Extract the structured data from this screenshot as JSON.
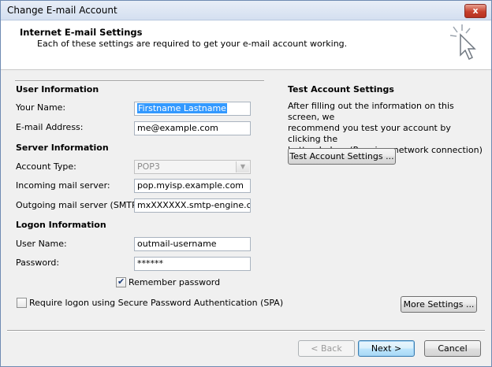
{
  "window": {
    "title": "Change E-mail Account",
    "close_label": "x"
  },
  "header": {
    "title": "Internet E-mail Settings",
    "subtitle": "Each of these settings are required to get your e-mail account working."
  },
  "user_info": {
    "section": "User Information",
    "name_label": "Your Name:",
    "name_value": "Firstname Lastname",
    "email_label": "E-mail Address:",
    "email_value": "me@example.com"
  },
  "server_info": {
    "section": "Server Information",
    "account_type_label": "Account Type:",
    "account_type_value": "POP3",
    "incoming_label": "Incoming mail server:",
    "incoming_value": "pop.myisp.example.com",
    "outgoing_label": "Outgoing mail server (SMTP):",
    "outgoing_value": "mxXXXXXX.smtp-engine.com"
  },
  "logon_info": {
    "section": "Logon Information",
    "user_label": "User Name:",
    "user_value": "outmail-username",
    "password_label": "Password:",
    "password_value": "******",
    "remember_label": "Remember password",
    "remember_checked": true,
    "spa_label": "Require logon using Secure Password Authentication (SPA)",
    "spa_checked": false
  },
  "test_settings": {
    "section": "Test Account Settings",
    "description_lines": [
      "After filling out the information on this screen, we",
      "recommend you test your account by clicking the",
      "button below. (Requires network connection)"
    ],
    "button_label": "Test Account Settings ..."
  },
  "more_settings_label": "More Settings ...",
  "footer": {
    "back_label": "< Back",
    "next_label": "Next >",
    "cancel_label": "Cancel"
  },
  "icons": {
    "close": "close-icon",
    "cursor": "cursor-sparkle-icon",
    "dropdown": "chevron-down-icon",
    "checkbox": "checkmark-icon"
  }
}
